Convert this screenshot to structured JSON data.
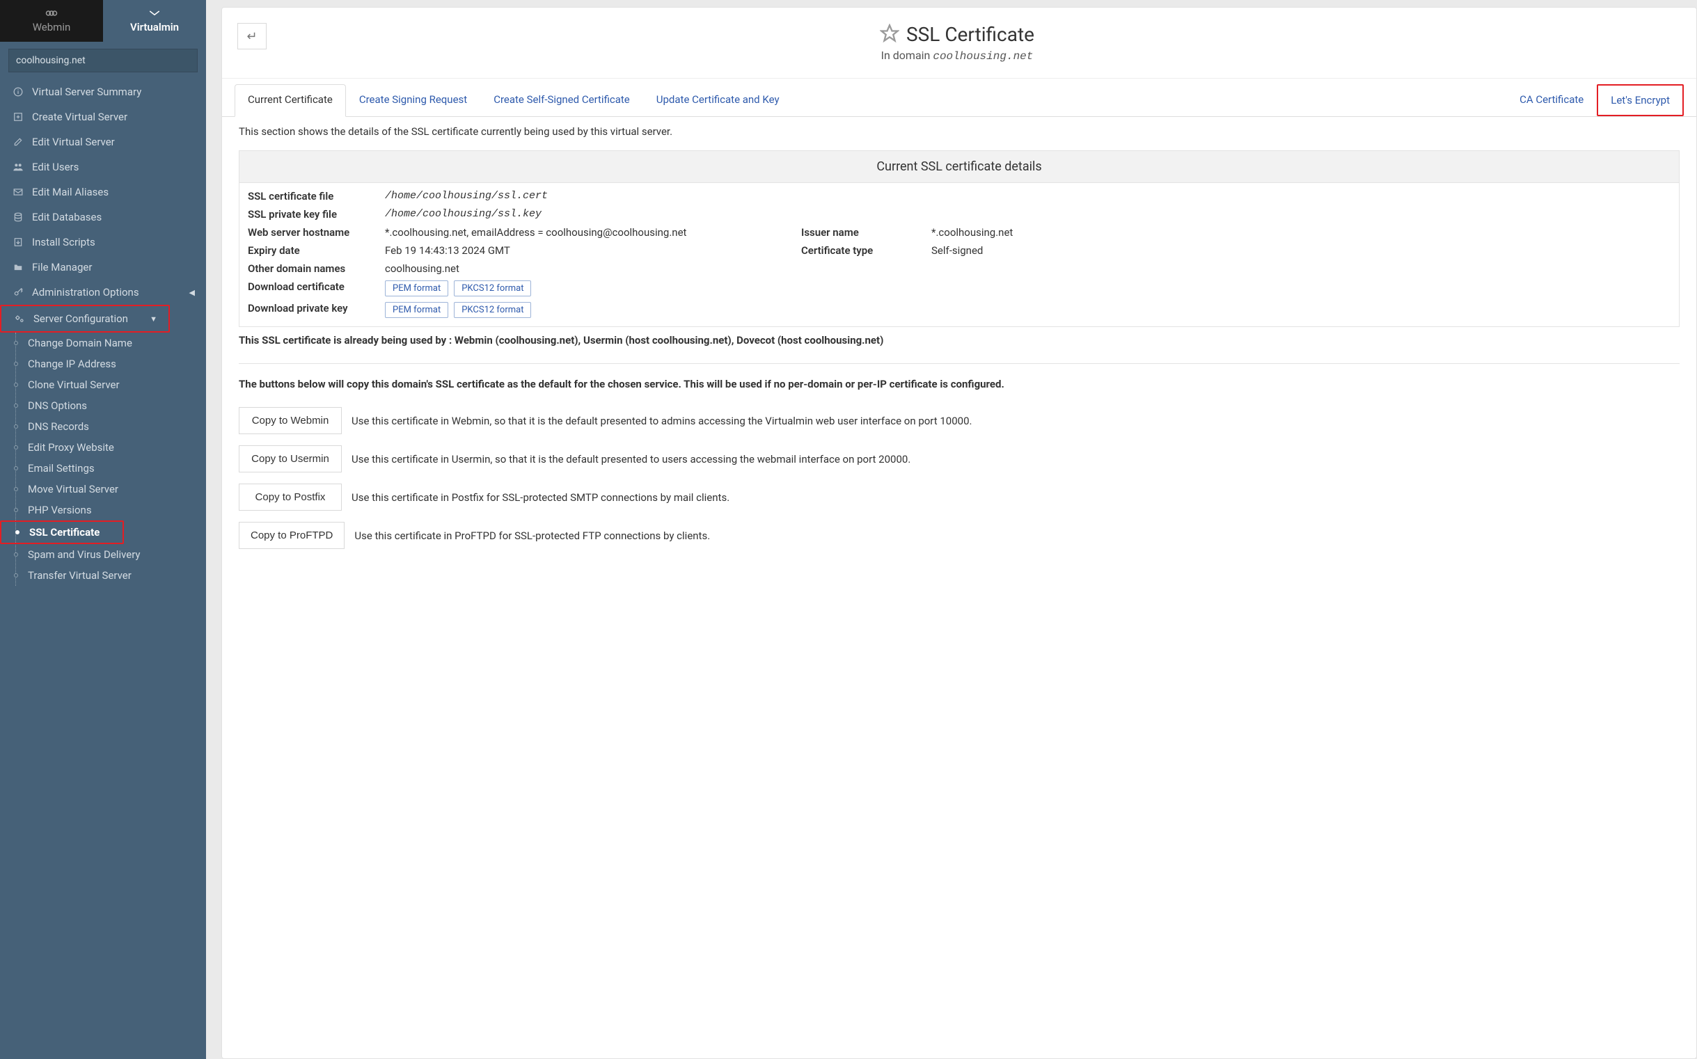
{
  "sidebar": {
    "tabs": {
      "webmin": "Webmin",
      "virtualmin": "Virtualmin"
    },
    "domain": "coolhousing.net",
    "items": [
      {
        "label": "Virtual Server Summary",
        "icon": "info"
      },
      {
        "label": "Create Virtual Server",
        "icon": "plus"
      },
      {
        "label": "Edit Virtual Server",
        "icon": "edit"
      },
      {
        "label": "Edit Users",
        "icon": "users"
      },
      {
        "label": "Edit Mail Aliases",
        "icon": "mail"
      },
      {
        "label": "Edit Databases",
        "icon": "db"
      },
      {
        "label": "Install Scripts",
        "icon": "script"
      },
      {
        "label": "File Manager",
        "icon": "folder"
      },
      {
        "label": "Administration Options",
        "icon": "key",
        "caret": "right"
      },
      {
        "label": "Server Configuration",
        "icon": "cogs",
        "caret": "down",
        "active": true
      }
    ],
    "subitems": [
      "Change Domain Name",
      "Change IP Address",
      "Clone Virtual Server",
      "DNS Options",
      "DNS Records",
      "Edit Proxy Website",
      "Email Settings",
      "Move Virtual Server",
      "PHP Versions",
      "SSL Certificate",
      "Spam and Virus Delivery",
      "Transfer Virtual Server"
    ],
    "active_subitem": 9
  },
  "page": {
    "title": "SSL Certificate",
    "subtitle_prefix": "In domain ",
    "subtitle_domain": "coolhousing.net"
  },
  "tabs": [
    "Current Certificate",
    "Create Signing Request",
    "Create Self-Signed Certificate",
    "Update Certificate and Key",
    "CA Certificate",
    "Let's Encrypt"
  ],
  "active_tab": 0,
  "highlighted_tab": 5,
  "intro": "This section shows the details of the SSL certificate currently being used by this virtual server.",
  "details": {
    "header": "Current SSL certificate details",
    "rows": {
      "cert_file_label": "SSL certificate file",
      "cert_file_value": "/home/coolhousing/ssl.cert",
      "key_file_label": "SSL private key file",
      "key_file_value": "/home/coolhousing/ssl.key",
      "hostname_label": "Web server hostname",
      "hostname_value": "*.coolhousing.net, emailAddress = coolhousing@coolhousing.net",
      "issuer_label": "Issuer name",
      "issuer_value": "*.coolhousing.net",
      "expiry_label": "Expiry date",
      "expiry_value": "Feb 19 14:43:13 2024 GMT",
      "cert_type_label": "Certificate type",
      "cert_type_value": "Self-signed",
      "other_names_label": "Other domain names",
      "other_names_value": "coolhousing.net",
      "dl_cert_label": "Download certificate",
      "dl_key_label": "Download private key",
      "pem": "PEM format",
      "pkcs12": "PKCS12 format"
    }
  },
  "usage": "This SSL certificate is already being used by : Webmin (coolhousing.net), Usermin (host coolhousing.net), Dovecot (host coolhousing.net)",
  "instruction": "The buttons below will copy this domain's SSL certificate as the default for the chosen service. This will be used if no per-domain or per-IP certificate is configured.",
  "actions": [
    {
      "label": "Copy to Webmin",
      "desc": "Use this certificate in Webmin, so that it is the default presented to admins accessing the Virtualmin web user interface on port 10000."
    },
    {
      "label": "Copy to Usermin",
      "desc": "Use this certificate in Usermin, so that it is the default presented to users accessing the webmail interface on port 20000."
    },
    {
      "label": "Copy to Postfix",
      "desc": "Use this certificate in Postfix for SSL-protected SMTP connections by mail clients."
    },
    {
      "label": "Copy to ProFTPD",
      "desc": "Use this certificate in ProFTPD for SSL-protected FTP connections by clients."
    }
  ]
}
